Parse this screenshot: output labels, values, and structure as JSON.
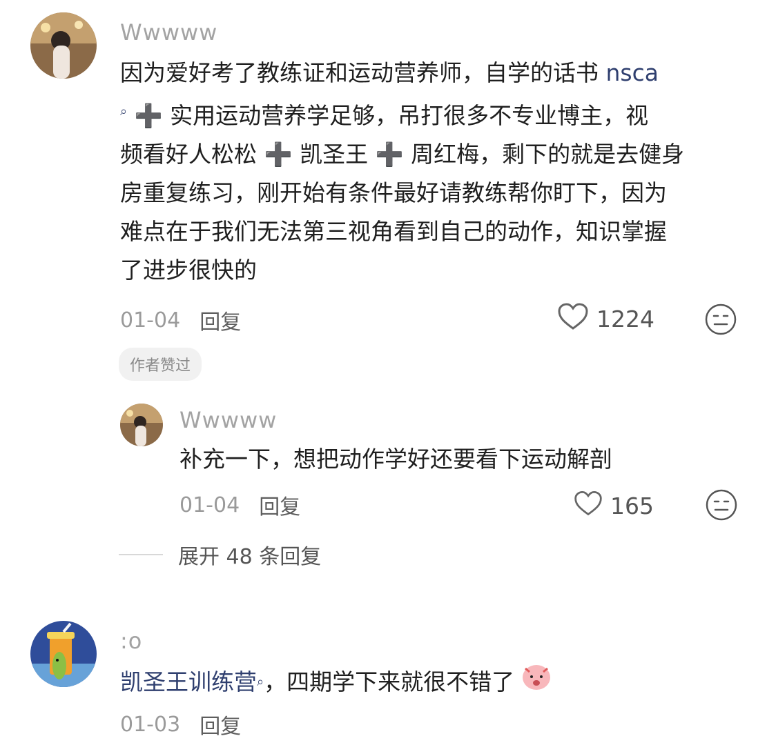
{
  "comment1": {
    "username": "Wwwww",
    "text_lines": [
      "因为爱好考了教练证和运动营养师，自学的话书 ",
      " ➕ 实用运动营养学足够，吊打很多不专业博主，视",
      "频看好人松松 ➕ 凯圣王 ➕ 周红梅，剩下的就是去健身",
      "房重复练习，刚开始有条件最好请教练帮你盯下，因为",
      "难点在于我们无法第三视角看到自己的动作，知识掌握",
      "了进步很快的"
    ],
    "link_text": "nsca",
    "date": "01-04",
    "reply_label": "回复",
    "likes": "1224",
    "author_tag": "作者赞过"
  },
  "reply1": {
    "username": "Wwwww",
    "text": "补充一下，想把动作学好还要看下运动解剖",
    "date": "01-04",
    "reply_label": "回复",
    "likes": "165"
  },
  "expand": {
    "label": "展开 48 条回复"
  },
  "comment2": {
    "username": ":o",
    "link_text": "凯圣王训练营",
    "text": "，四期学下来就很不错了",
    "date": "01-03",
    "reply_label": "回复"
  },
  "colors": {
    "link": "#2f3f6f",
    "username": "#a3a3a3",
    "meta": "#9a9a9a"
  },
  "icons": [
    "heart-icon",
    "meh-face-icon",
    "search-small-icon",
    "emoji-icon"
  ]
}
